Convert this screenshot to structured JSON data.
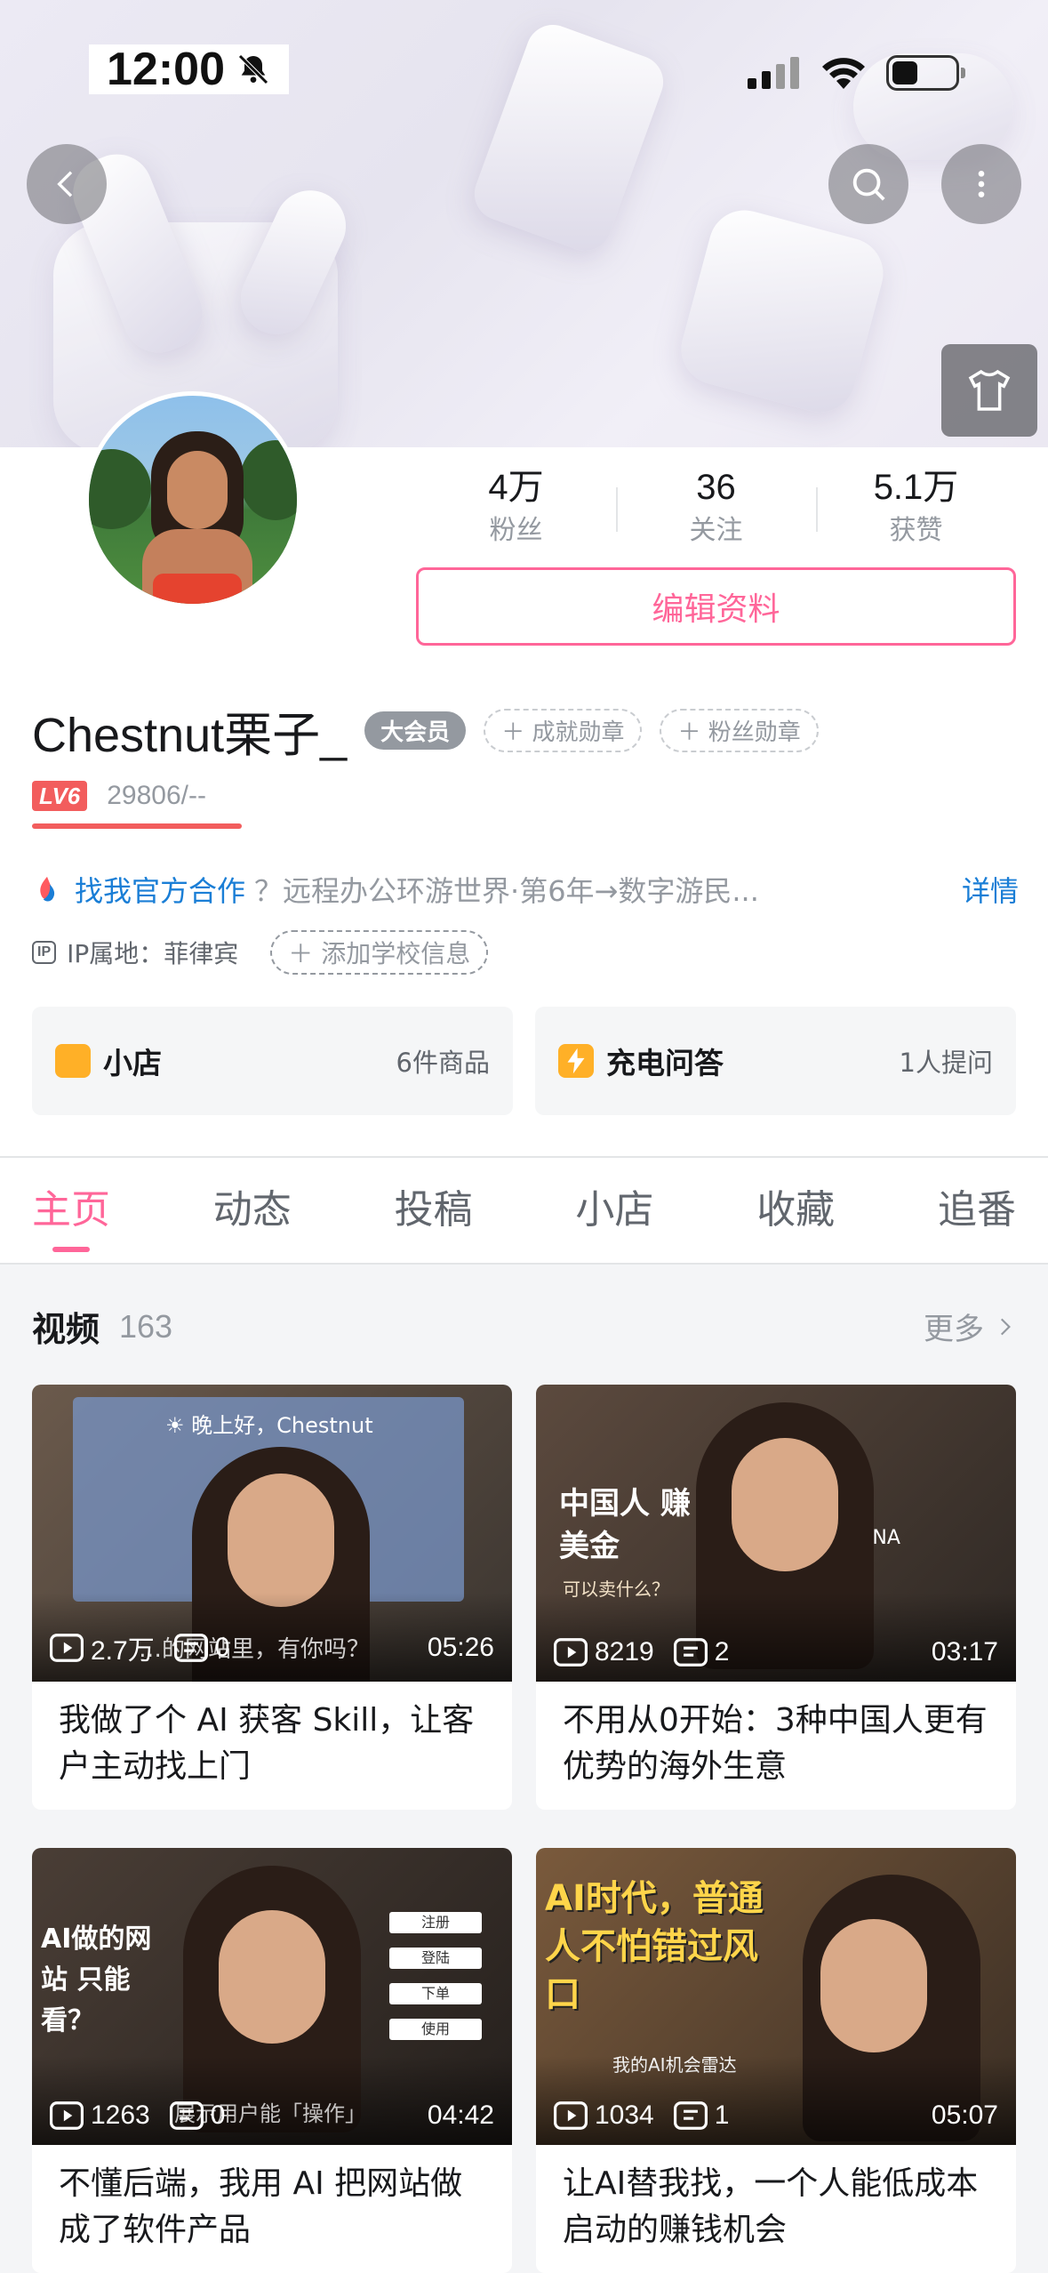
{
  "status": {
    "time": "12:00"
  },
  "stats": [
    {
      "value": "4万",
      "label": "粉丝"
    },
    {
      "value": "36",
      "label": "关注"
    },
    {
      "value": "5.1万",
      "label": "获赞"
    }
  ],
  "edit_label": "编辑资料",
  "profile": {
    "name": "Chestnut栗子_",
    "vip": "大会员",
    "medal1": "成就勋章",
    "medal2": "粉丝勋章",
    "level": "LV6",
    "exp": "29806/--",
    "coop": "找我官方合作",
    "bio": "？远程办公环游世界·第6年→数字游民...",
    "details": "详情",
    "ip": "IP属地：菲律宾",
    "school": "添加学校信息"
  },
  "cards": [
    {
      "title": "小店",
      "sub": "6件商品"
    },
    {
      "title": "充电问答",
      "sub": "1人提问"
    }
  ],
  "tabs": [
    "主页",
    "动态",
    "投稿",
    "小店",
    "收藏",
    "追番"
  ],
  "videos_section": {
    "title": "视频",
    "count": "163",
    "more": "更多"
  },
  "videos": [
    {
      "plays": "2.7万",
      "comments": "0",
      "duration": "05:26",
      "title": "我做了个 AI 获客 Skill，让客户主动找上门",
      "overlay": "☀ 晚上好，Chestnut",
      "caption": "…的网站里，有你吗？"
    },
    {
      "plays": "8219",
      "comments": "2",
      "duration": "03:17",
      "title": "不用从0开始：3种中国人更有优势的海外生意",
      "overlay": "中国人 赚美金",
      "overlay2": "可以卖什么？",
      "overlay3": "CHINA"
    },
    {
      "plays": "1263",
      "comments": "0",
      "duration": "04:42",
      "title": "不懂后端，我用 AI 把网站做成了软件产品",
      "overlay": "AI做的网站 只能看？",
      "caption": "展示用户能「操作」",
      "buttons": [
        "注册",
        "登陆",
        "下单",
        "使用"
      ]
    },
    {
      "plays": "1034",
      "comments": "1",
      "duration": "05:07",
      "title": "让AI替我找，一个人能低成本启动的赚钱机会",
      "overlay": "AI时代，普通人不怕错过风口",
      "overlay2": "我的AI机会雷达"
    }
  ],
  "colors": {
    "accent": "#ff6699",
    "link": "#1a7ed6",
    "level": "#f25d5d"
  }
}
